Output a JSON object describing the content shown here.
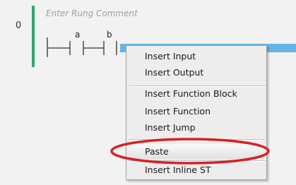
{
  "rung": {
    "number": "0",
    "comment_placeholder": "Enter Rung Comment",
    "contacts": [
      "a",
      "b"
    ]
  },
  "context_menu": {
    "items": [
      "Insert Input",
      "Insert Output",
      "Insert Function Block",
      "Insert Function",
      "Insert Jump",
      "Paste",
      "Insert Inline ST"
    ]
  },
  "colors": {
    "rail": "#2fa66b",
    "selection": "#64b5e6",
    "annotation": "#d62222"
  }
}
